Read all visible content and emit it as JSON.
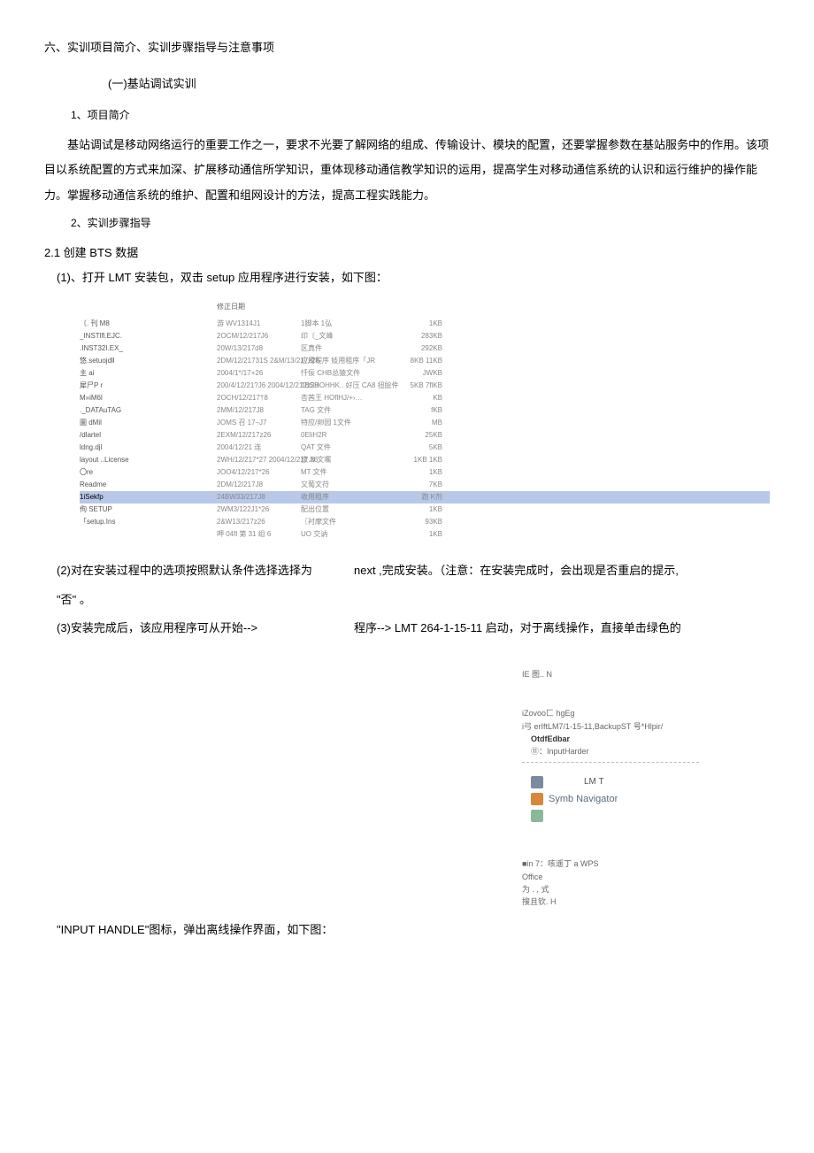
{
  "headings": {
    "main": "六、实训项目简介、实训步骤指导与注意事项",
    "sub1": "(一)基站调试实训",
    "proj_intro": "1、项目简介",
    "step_guide": "2、实训步骤指导",
    "create_bts": "2.1 创建 BTS 数据"
  },
  "paragraphs": {
    "intro": "基站调试是移动网络运行的重要工作之一，要求不光要了解网络的组成、传输设计、模块的配置，还要掌握参数在基站服务中的作用。该项目以系统配置的方式来加深、扩展移动通信所学知识，重体现移动通信教学知识的运用，提高学生对移动通信系统的认识和运行维护的操作能力。掌握移动通信系统的维护、配置和组网设计的方法，提高工程实践能力。"
  },
  "steps": {
    "s1": "(1)、打开 LMT 安装包，双击 setup 应用程序进行安装，如下图：",
    "s2_left": "(2)对在安装过程中的选项按照默认条件选择选择为",
    "s2_right": "next ,完成安装。（注意：在安装完成时，会出现是否重启的提示,",
    "s2_cont": "\"否\" 。",
    "s3_left": "(3)安装完成后，该应用程序可从开始-->",
    "s3_right": "程序--> LMT 264-1-15-11 启动，对于离线操作，直接单击绿色的",
    "bottom": "\"INPUT HANDLE\"图标，弹出离线操作界面，如下图："
  },
  "file_table": {
    "header": "修正日期",
    "rows": [
      {
        "name": "〔. 刊 M8",
        "date": "游 WV1314J1",
        "type": "1脚本 1弘",
        "size": "1KB",
        "hl": false
      },
      {
        "name": "_INSTlfl.EJC.",
        "date": "2OCM/12/217J6",
        "type": "印〔_文峰",
        "size": "283KB",
        "hl": false
      },
      {
        "name": ".INST32I.EX_",
        "date": "20W/13/217d8",
        "type": "区真件",
        "size": "292KB",
        "hl": false
      },
      {
        "name": "悠.setuojdll",
        "date": "2DM/12/21731S\n2&M/13/217z28",
        "type": "应用程序\n妓用租序「JR",
        "size": "8KB\n11KB",
        "hl": false
      },
      {
        "name": "主 ai",
        "date": "2004/1*/17+26",
        "type": "忏佞 CHB总猿文件",
        "size": "JWKB",
        "hl": false
      },
      {
        "name": "犀尸P r",
        "date": "200/4/12/21?J6\n2004/12/21?z28",
        "type": "1BSHOHHK..\n好压 CA8 扭脍件",
        "size": "5KB\n7flKB",
        "hl": false
      },
      {
        "name": "M»iM6l",
        "date": "2OCH/12/217†8",
        "type": "杏茜王 HOflHJ/+›…",
        "size": "KB",
        "hl": false
      },
      {
        "name": "._DATAuTAG",
        "date": "2MM/12/217J8",
        "type": "TAG 文件",
        "size": "fKB",
        "hl": false
      },
      {
        "name": "圖 dMil",
        "date": "JOMS 召 17–J7",
        "type": "特应/卵园 1文件",
        "size": "MB",
        "hl": false
      },
      {
        "name": "/dlartel",
        "date": "2EXM/12/217z26",
        "type": "0EliH2R",
        "size": "25KB",
        "hl": false
      },
      {
        "name": "    ldng.djl",
        "date": "2004/12/21 连",
        "type": "QAT 文件",
        "size": "5KB",
        "hl": false
      },
      {
        "name": "    layout\n    ..License",
        "date": "2WH/12/217*27\n2004/12/217.26",
        "type": "旅 N 文嘱",
        "size": "1KB\n1KB",
        "hl": false
      },
      {
        "name": "〇re",
        "date": "JOO4/12/217*26",
        "type": "MT 文件",
        "size": "1KB",
        "hl": false
      },
      {
        "name": "    Readme",
        "date": "2DM/12/217J8",
        "type": "又葡文苻",
        "size": "7KB",
        "hl": false
      },
      {
        "name": "1iSekfp",
        "date": "24BW33/217J8",
        "type": "收用租序",
        "size": "跑 K剂",
        "hl": true
      },
      {
        "name": "佝 SETUP",
        "date": "2WM3/122J1*26",
        "type": "配出位置",
        "size": "1KB",
        "hl": false
      },
      {
        "name": "「setup.Ins",
        "date": "2&W13/217z26",
        "type": "〖衬摩文件",
        "size": "93KB",
        "hl": false
      },
      {
        "name": "",
        "date": "呷 04fl 第 31 组 6",
        "type": "UO 交讷",
        "size": "1KB",
        "hl": false
      }
    ]
  },
  "start_menu": {
    "top1": "IE 图..  N",
    "line1": "iZovoo匚 hgEg",
    "line2": "i弓 erIftLM7/1-15-11,BackupST 号*Hlpir/",
    "bold1": "OtdfEdbar",
    "bold2": "⑪：InputHarder",
    "item1": "LM T",
    "item2": "Symb Navigator",
    "bottom1": "■in 7：咳遥丁 a WPS",
    "bottom2": "Office",
    "bottom3": "为 .  , 式",
    "bottom4": "搜且钦.  H"
  }
}
